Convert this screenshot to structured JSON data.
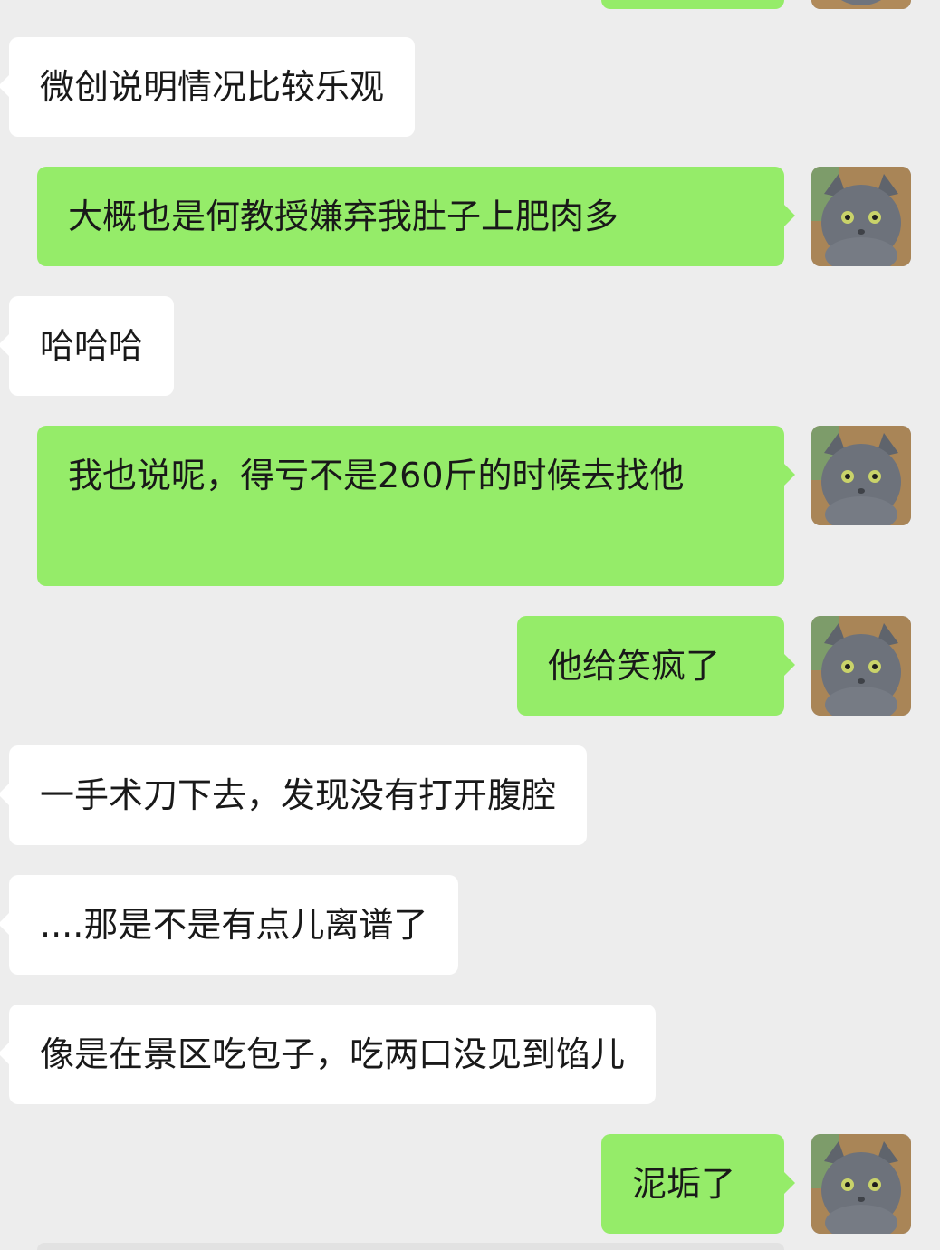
{
  "messages": [
    {
      "side": "left",
      "text": "微创说明情况比较乐观"
    },
    {
      "side": "right",
      "text": "大概也是何教授嫌弃我肚子上肥肉多"
    },
    {
      "side": "left",
      "text": "哈哈哈"
    },
    {
      "side": "right",
      "text": "我也说呢，得亏不是260斤的时候去找他"
    },
    {
      "side": "right",
      "text": "他给笑疯了"
    },
    {
      "side": "left",
      "text": "一手术刀下去，发现没有打开腹腔"
    },
    {
      "side": "left",
      "text": "....那是不是有点儿离谱了"
    },
    {
      "side": "left",
      "text": "像是在景区吃包子，吃两口没见到馅儿"
    },
    {
      "side": "right",
      "text": "泥垢了"
    }
  ],
  "avatar": {
    "icon": "cat-avatar-icon",
    "bg": "#8b8f97"
  },
  "colors": {
    "background": "#ededed",
    "incoming": "#ffffff",
    "outgoing": "#95ec69",
    "text": "#191919"
  }
}
